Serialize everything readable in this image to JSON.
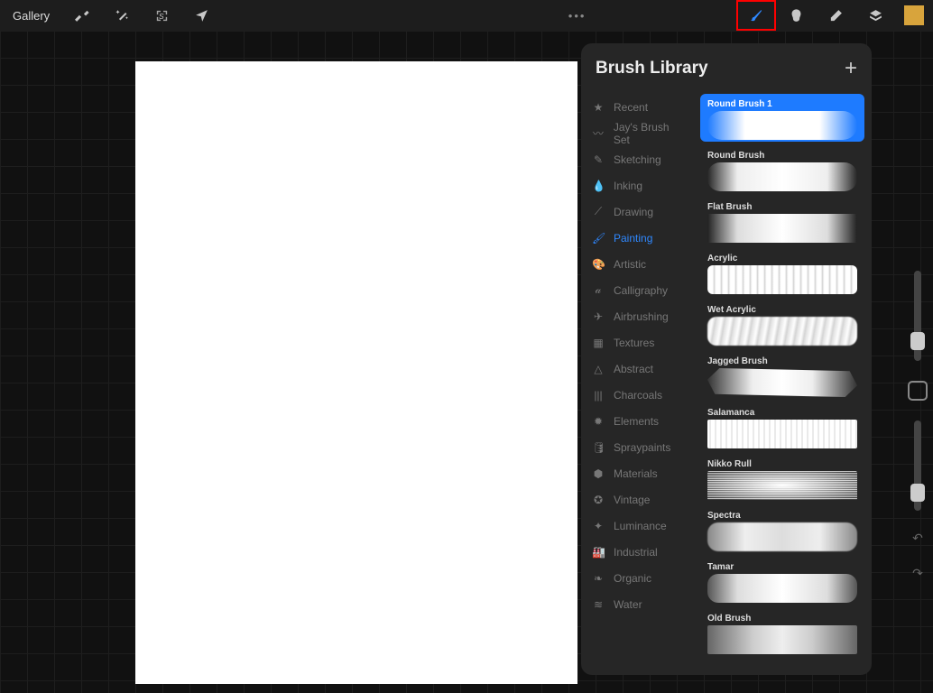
{
  "topbar": {
    "gallery": "Gallery"
  },
  "panel": {
    "title": "Brush Library",
    "categories": [
      {
        "icon": "★",
        "label": "Recent"
      },
      {
        "icon": "〰",
        "label": "Jay's Brush Set"
      },
      {
        "icon": "✎",
        "label": "Sketching"
      },
      {
        "icon": "💧",
        "label": "Inking"
      },
      {
        "icon": "⟋",
        "label": "Drawing"
      },
      {
        "icon": "🖌",
        "label": "Painting",
        "active": true
      },
      {
        "icon": "🎨",
        "label": "Artistic"
      },
      {
        "icon": "𝒶",
        "label": "Calligraphy"
      },
      {
        "icon": "✈",
        "label": "Airbrushing"
      },
      {
        "icon": "▦",
        "label": "Textures"
      },
      {
        "icon": "△",
        "label": "Abstract"
      },
      {
        "icon": "|||",
        "label": "Charcoals"
      },
      {
        "icon": "✹",
        "label": "Elements"
      },
      {
        "icon": "🛢",
        "label": "Spraypaints"
      },
      {
        "icon": "⬢",
        "label": "Materials"
      },
      {
        "icon": "✪",
        "label": "Vintage"
      },
      {
        "icon": "✦",
        "label": "Luminance"
      },
      {
        "icon": "🏭",
        "label": "Industrial"
      },
      {
        "icon": "❧",
        "label": "Organic"
      },
      {
        "icon": "≋",
        "label": "Water"
      }
    ],
    "brushes": [
      {
        "name": "Round Brush 1",
        "selected": true
      },
      {
        "name": "Round Brush"
      },
      {
        "name": "Flat Brush"
      },
      {
        "name": "Acrylic"
      },
      {
        "name": "Wet Acrylic"
      },
      {
        "name": "Jagged Brush"
      },
      {
        "name": "Salamanca"
      },
      {
        "name": "Nikko Rull"
      },
      {
        "name": "Spectra"
      },
      {
        "name": "Tamar"
      },
      {
        "name": "Old Brush"
      }
    ]
  },
  "colors": {
    "swatch": "#d8a43c",
    "accent": "#1E7BFF"
  }
}
